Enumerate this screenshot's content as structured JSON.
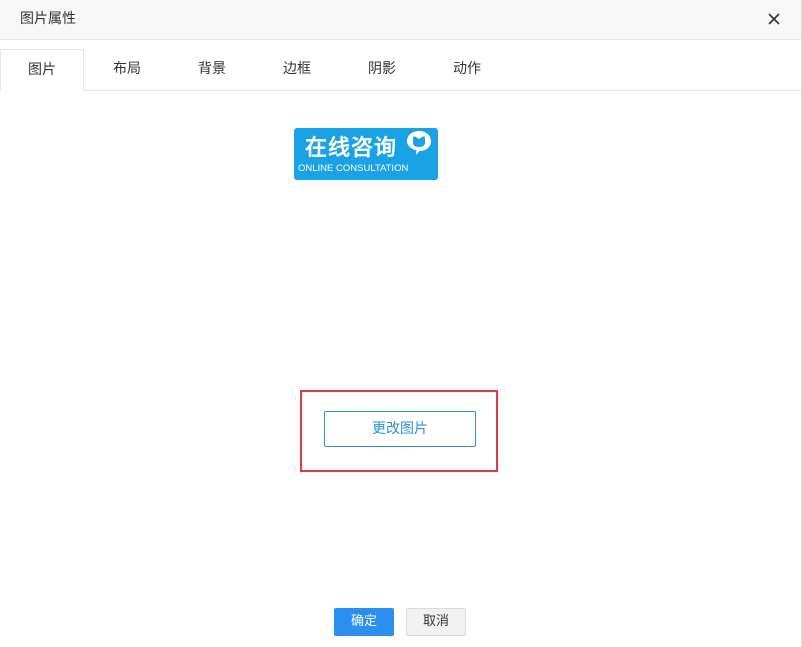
{
  "dialog": {
    "title": "图片属性",
    "close_icon": "close-icon"
  },
  "tabs": [
    {
      "label": "图片",
      "active": true
    },
    {
      "label": "布局",
      "active": false
    },
    {
      "label": "背景",
      "active": false
    },
    {
      "label": "边框",
      "active": false
    },
    {
      "label": "阴影",
      "active": false
    },
    {
      "label": "动作",
      "active": false
    }
  ],
  "preview_image": {
    "text_cn": "在线咨询",
    "text_en": "ONLINE CONSULTATION",
    "bubble_icon": "chat-bubble-icon",
    "background_color": "#1aa2e6"
  },
  "change_image_button": {
    "label": "更改图片"
  },
  "footer": {
    "ok_label": "确定",
    "cancel_label": "取消"
  },
  "colors": {
    "primary": "#2b8ff0",
    "link": "#2d8fd5",
    "highlight": "#e2393d"
  }
}
